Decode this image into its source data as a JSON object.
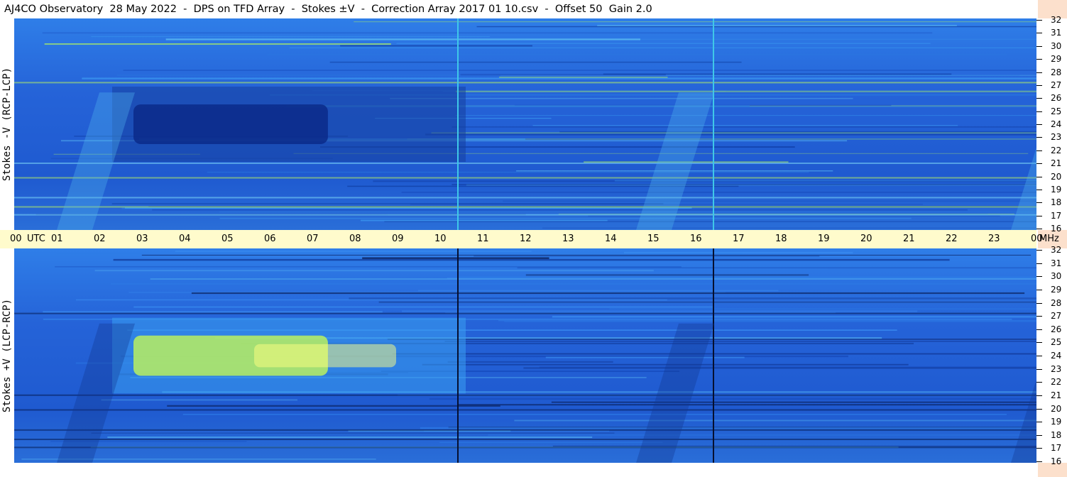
{
  "header": {
    "title": "AJ4CO Observatory  28 May 2022  -  DPS on TFD Array  -  Stokes ±V  -  Correction Array 2017 01 10.csv  -  Offset 50  Gain 2.0"
  },
  "colors": {
    "background_low": "#0a2a8a",
    "background_mid": "#1a64d8",
    "background_high": "#2ea0f0",
    "emission": "#b8f060",
    "hot": "#ffff80",
    "axis_band": "#fffbcc",
    "side_strip": "#fce0cc"
  },
  "chart_data": [
    {
      "type": "heatmap",
      "title": "",
      "ylabel": "Stokes -V (RCP-LCP)",
      "xlabel": "",
      "x_ticks": [
        "00",
        "UTC",
        "01",
        "02",
        "03",
        "04",
        "05",
        "06",
        "07",
        "08",
        "09",
        "10",
        "11",
        "12",
        "13",
        "14",
        "15",
        "16",
        "17",
        "18",
        "19",
        "20",
        "21",
        "22",
        "23",
        "00"
      ],
      "x_unit": "UTC",
      "xlim_hours": [
        0,
        24
      ],
      "y_ticks": [
        "32",
        "31",
        "30",
        "29",
        "28",
        "27",
        "26",
        "25",
        "24",
        "23",
        "22",
        "21",
        "20",
        "19",
        "18",
        "17",
        "16"
      ],
      "y_unit": "MHz",
      "ylim_mhz": [
        16,
        32
      ],
      "features": [
        {
          "kind": "absorption_band",
          "t_start": 2.3,
          "t_end": 10.6,
          "f_low": 22.5,
          "f_high": 25.5,
          "level": "dark"
        },
        {
          "kind": "vertical_line",
          "t": 10.4,
          "level": "bright"
        },
        {
          "kind": "vertical_line",
          "t": 16.4,
          "level": "bright"
        }
      ]
    },
    {
      "type": "heatmap",
      "title": "",
      "ylabel": "Stokes +V (LCP-RCP)",
      "xlabel": "",
      "x_unit": "UTC",
      "xlim_hours": [
        0,
        24
      ],
      "y_ticks": [
        "32",
        "31",
        "30",
        "29",
        "28",
        "27",
        "26",
        "25",
        "24",
        "23",
        "22",
        "21",
        "20",
        "19",
        "18",
        "17",
        "16"
      ],
      "y_unit": "MHz",
      "ylim_mhz": [
        16,
        32
      ],
      "features": [
        {
          "kind": "emission_band",
          "t_start": 2.3,
          "t_end": 10.6,
          "f_low": 22.5,
          "f_high": 25.5,
          "level": "bright"
        },
        {
          "kind": "vertical_line",
          "t": 10.4,
          "level": "dark"
        },
        {
          "kind": "vertical_line",
          "t": 16.4,
          "level": "dark"
        }
      ]
    }
  ],
  "axes": {
    "time_labels": [
      "00",
      "UTC",
      "01",
      "02",
      "03",
      "04",
      "05",
      "06",
      "07",
      "08",
      "09",
      "10",
      "11",
      "12",
      "13",
      "14",
      "15",
      "16",
      "17",
      "18",
      "19",
      "20",
      "21",
      "22",
      "23",
      "00",
      "MHz"
    ],
    "freq_labels": [
      "32",
      "31",
      "30",
      "29",
      "28",
      "27",
      "26",
      "25",
      "24",
      "23",
      "22",
      "21",
      "20",
      "19",
      "18",
      "17",
      "16"
    ]
  }
}
